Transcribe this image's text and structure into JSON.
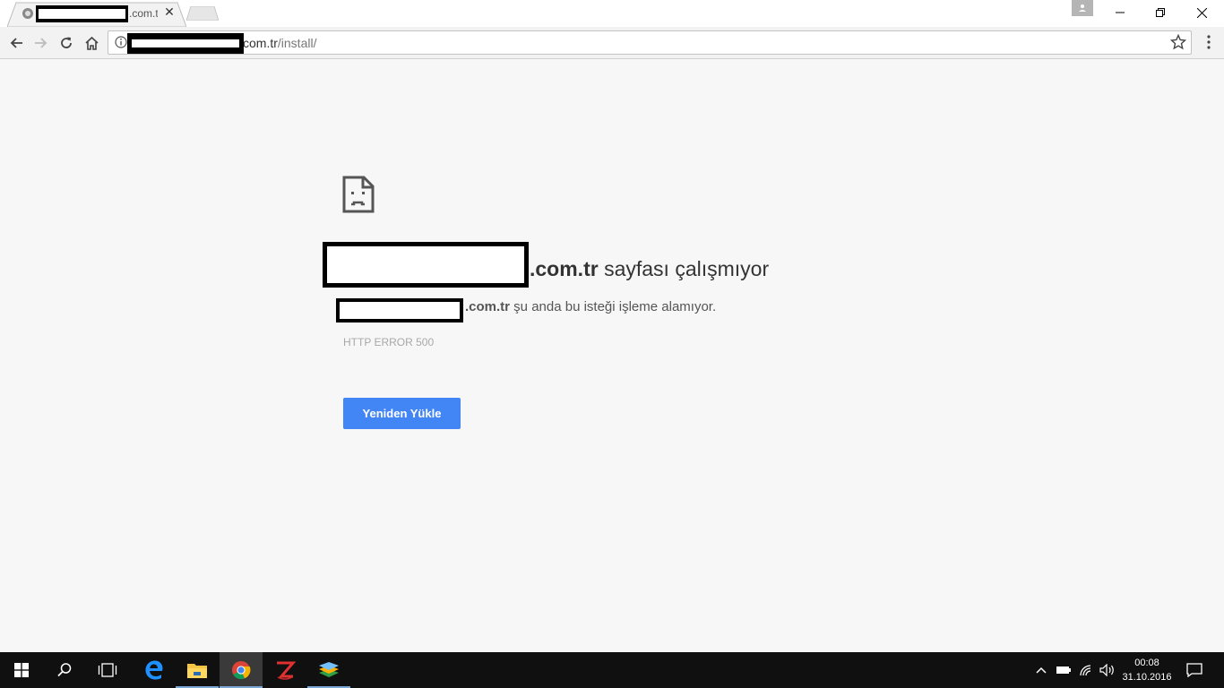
{
  "tab": {
    "title": ".com.tr",
    "close": "✕"
  },
  "address": {
    "host_suffix": "com.tr",
    "path": "/install/"
  },
  "error": {
    "heading_domain": ".com.tr",
    "heading_text": " sayfası çalışmıyor",
    "desc_domain": ".com.tr",
    "desc_text": " şu anda bu isteği işleme alamıyor.",
    "code": "HTTP ERROR 500",
    "reload_label": "Yeniden Yükle"
  },
  "clock": {
    "time": "00:08",
    "date": "31.10.2016"
  },
  "colors": {
    "accent": "#4285f4",
    "taskbar": "#101010",
    "page_bg": "#f7f7f7"
  }
}
